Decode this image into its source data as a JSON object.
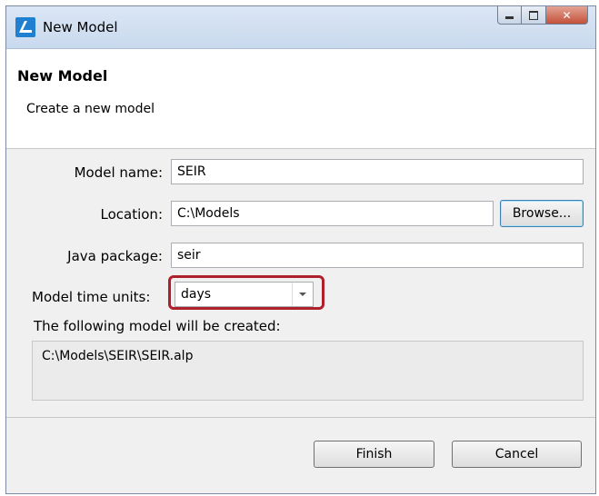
{
  "window": {
    "title": "New Model",
    "controls": {
      "minimize": "minimize",
      "maximize": "maximize",
      "close": "close"
    }
  },
  "header": {
    "title": "New Model",
    "description": "Create a new model"
  },
  "form": {
    "model_name": {
      "label": "Model name:",
      "value": "SEIR"
    },
    "location": {
      "label": "Location:",
      "value": "C:\\Models",
      "browse_label": "Browse..."
    },
    "java_package": {
      "label": "Java package:",
      "value": "seir"
    },
    "time_units": {
      "label": "Model time units:",
      "value": "days"
    },
    "result": {
      "label": "The following model will be created:",
      "path": "C:\\Models\\SEIR\\SEIR.alp"
    }
  },
  "footer": {
    "finish_label": "Finish",
    "cancel_label": "Cancel"
  },
  "colors": {
    "highlight": "#b0202a",
    "app_icon": "#1f7fd0"
  }
}
